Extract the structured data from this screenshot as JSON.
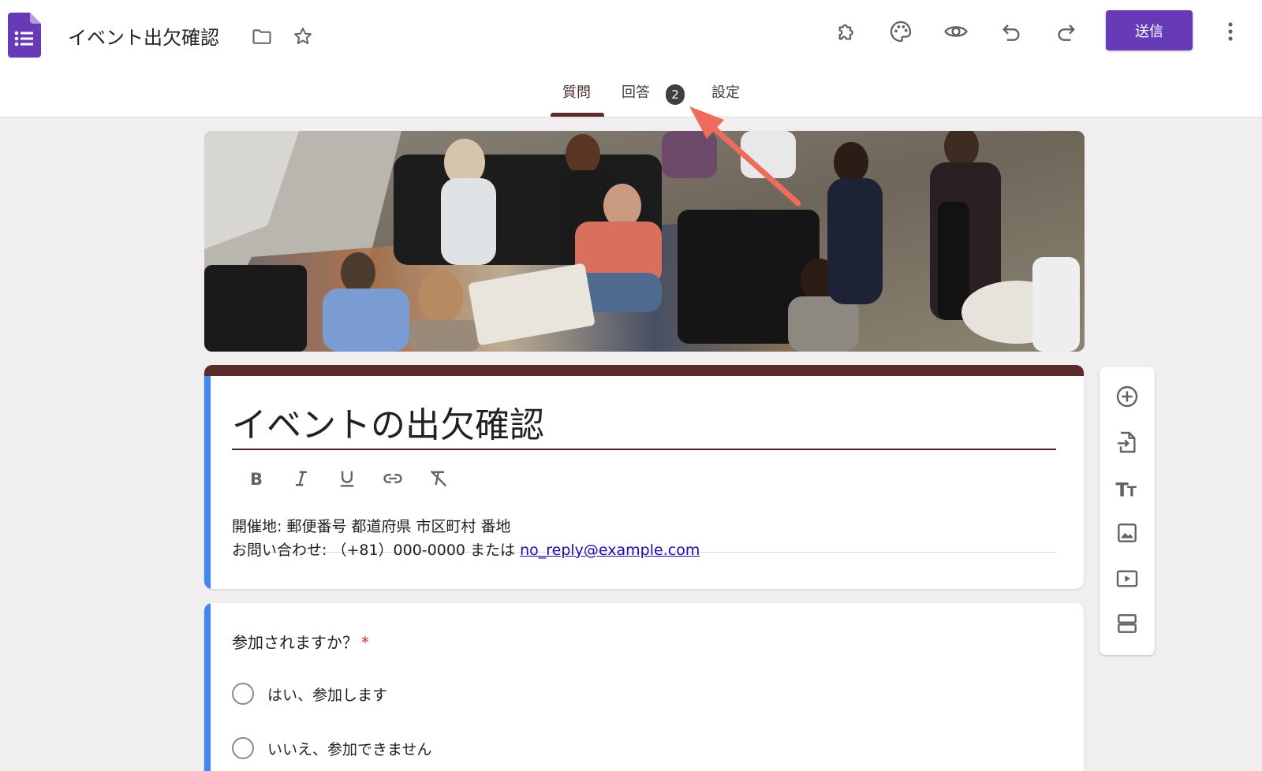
{
  "header": {
    "app_icon": "google-forms-icon",
    "doc_title": "イベント出欠確認",
    "send_label": "送信",
    "toolbar_icons": [
      "addon-puzzle-icon",
      "palette-icon",
      "preview-eye-icon",
      "undo-icon",
      "redo-icon"
    ],
    "more_icon": "more-vertical-icon"
  },
  "tabs": [
    {
      "label": "質問",
      "active": true
    },
    {
      "label": "回答",
      "badge": "2"
    },
    {
      "label": "設定"
    }
  ],
  "form": {
    "title": "イベントの出欠確認",
    "formatting": [
      "bold-icon",
      "italic-icon",
      "underline-icon",
      "link-icon",
      "clear-format-icon"
    ],
    "description_line1": "開催地: 郵便番号 都道府県 市区町村 番地",
    "description_line2_prefix": "お問い合わせ: （+81）000-0000 または ",
    "description_email": "no_reply@example.com"
  },
  "question": {
    "title": "参加されますか？",
    "required_mark": "*",
    "options": [
      "はい、参加します",
      "いいえ、参加できません"
    ]
  },
  "side_toolbar": [
    "add-question-icon",
    "import-questions-icon",
    "add-title-icon",
    "add-image-icon",
    "add-video-icon",
    "add-section-icon"
  ],
  "colors": {
    "accent": "#673ab7",
    "theme": "#5a2a2a",
    "card_left_bar": "#4285f4",
    "annotation_arrow": "#ee6c5c",
    "background": "#f0eeee"
  }
}
